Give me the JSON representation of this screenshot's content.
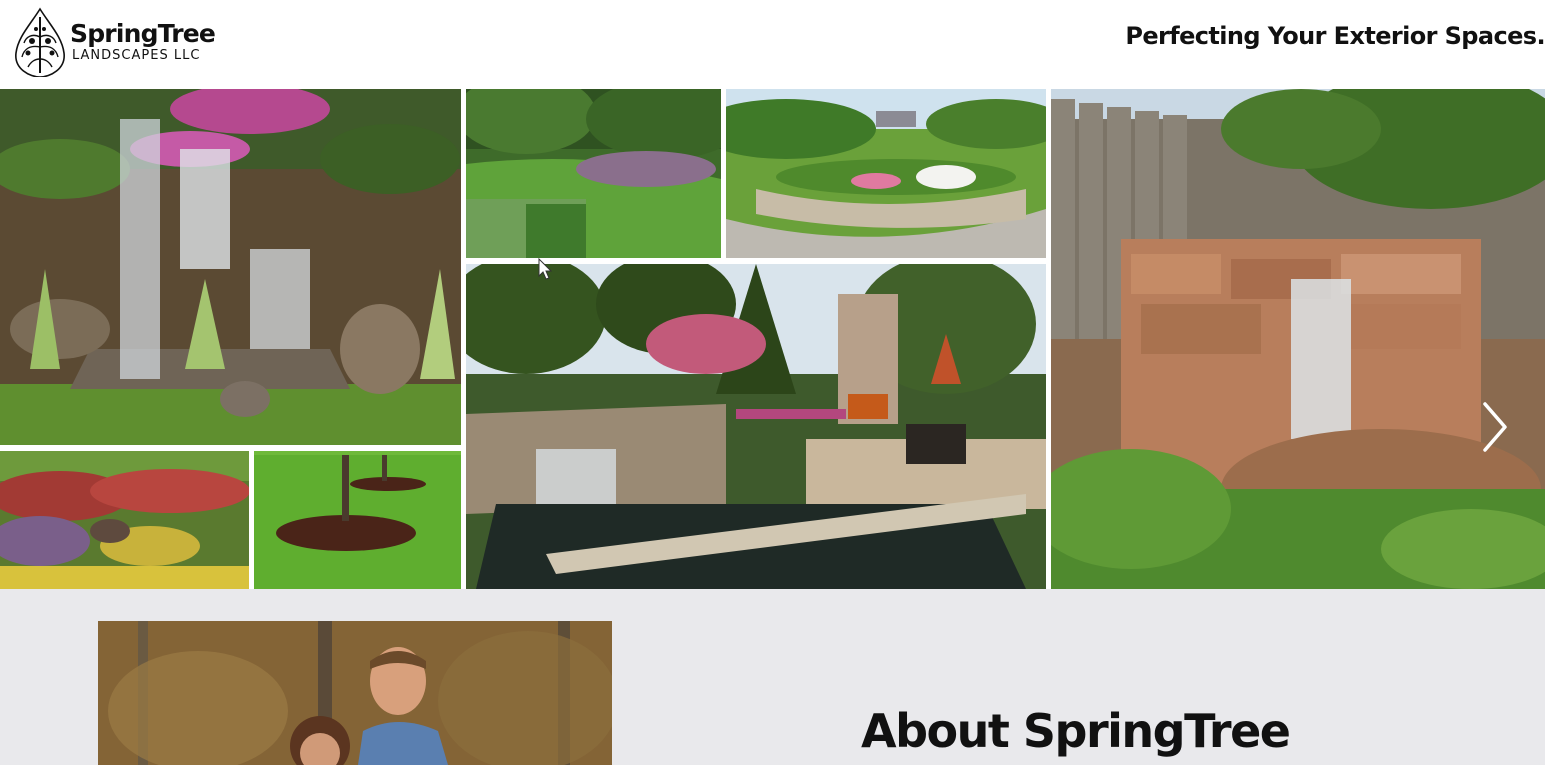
{
  "header": {
    "logo_name": "SpringTree",
    "logo_sub": "LANDSCAPES LLC",
    "tagline": "Perfecting Your Exterior Spaces."
  },
  "gallery": {
    "images": [
      "waterfall-garden",
      "lawn-garden-path",
      "curved-paver-walkway",
      "patio-pond-fireplace",
      "stone-waterfall-fence",
      "flower-bed",
      "mulched-tree-rings"
    ],
    "next_icon": "chevron-right-icon"
  },
  "about": {
    "title": "About SpringTree"
  },
  "colors": {
    "text": "#111111",
    "about_bg": "#e9e9ec"
  }
}
